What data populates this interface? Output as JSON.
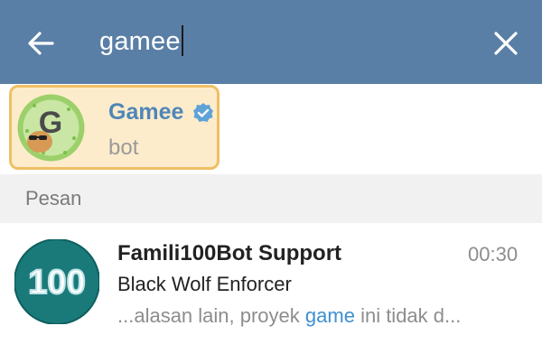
{
  "search": {
    "query": "gamee"
  },
  "colors": {
    "header": "#5a7fa6",
    "highlight": "#fdeccb",
    "highlight_border": "#f0bf63",
    "link": "#3f8fd1"
  },
  "icons": {
    "back": "arrow-left-icon",
    "close": "close-icon",
    "verified": "verified-badge-icon"
  },
  "results": {
    "top": {
      "name": "Gamee",
      "subtitle": "bot",
      "avatar_letter": "G",
      "verified": true
    }
  },
  "section": {
    "label": "Pesan"
  },
  "messages": [
    {
      "title": "Famili100Bot Support",
      "time": "00:30",
      "sender": "Black Wolf Enforcer",
      "preview_before": "...alasan lain, proyek ",
      "preview_keyword": "game",
      "preview_after": " ini tidak d...",
      "avatar_text": "100"
    }
  ]
}
